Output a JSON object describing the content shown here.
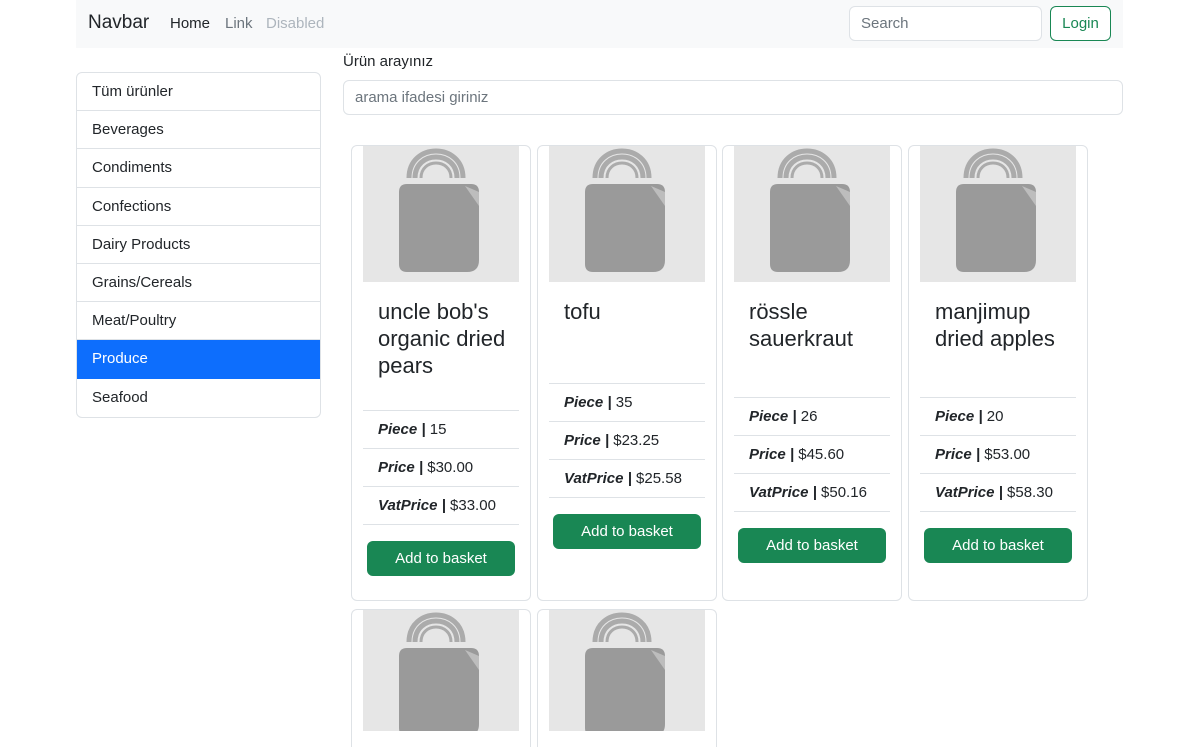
{
  "navbar": {
    "brand": "Navbar",
    "links": [
      "Home",
      "Link",
      "Disabled"
    ],
    "search_placeholder": "Search",
    "login_label": "Login"
  },
  "sidebar": {
    "items": [
      {
        "label": "Tüm ürünler",
        "active": false
      },
      {
        "label": "Beverages",
        "active": false
      },
      {
        "label": "Condiments",
        "active": false
      },
      {
        "label": "Confections",
        "active": false
      },
      {
        "label": "Dairy Products",
        "active": false
      },
      {
        "label": "Grains/Cereals",
        "active": false
      },
      {
        "label": "Meat/Poultry",
        "active": false
      },
      {
        "label": "Produce",
        "active": true
      },
      {
        "label": "Seafood",
        "active": false
      }
    ]
  },
  "search": {
    "label": "Ürün arayınız",
    "placeholder": "arama ifadesi giriniz"
  },
  "labels": {
    "piece": "Piece",
    "price": "Price",
    "vat_price": "VatPrice",
    "add_to_basket": "Add to basket"
  },
  "products": [
    {
      "name": "uncle bob's organic dried pears",
      "piece": "15",
      "price": "$30.00",
      "vat_price": "$33.00",
      "image_icon": "shopping-bag-icon"
    },
    {
      "name": "tofu",
      "piece": "35",
      "price": "$23.25",
      "vat_price": "$25.58",
      "image_icon": "shopping-bag-icon"
    },
    {
      "name": "rössle sauerkraut",
      "piece": "26",
      "price": "$45.60",
      "vat_price": "$50.16",
      "image_icon": "shopping-bag-icon"
    },
    {
      "name": "manjimup dried apples",
      "piece": "20",
      "price": "$53.00",
      "vat_price": "$58.30",
      "image_icon": "shopping-bag-icon"
    },
    {
      "image_icon": "shopping-bag-icon"
    },
    {
      "image_icon": "shopping-bag-icon"
    }
  ],
  "colors": {
    "primary": "#0d6efd",
    "success": "#198754",
    "navbar_bg": "#f8f9fa",
    "image_placeholder_bg": "#e6e6e6",
    "icon_gray": "#999999"
  }
}
